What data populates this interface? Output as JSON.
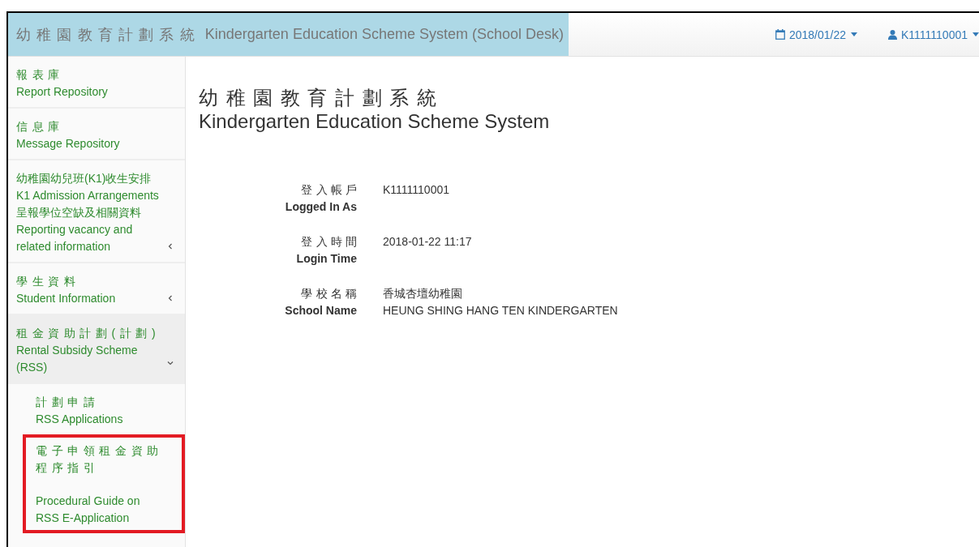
{
  "header": {
    "title_zh": "幼稚園教育計劃系統",
    "title_en": "Kindergarten Education Scheme System (School Desk)",
    "date": "2018/01/22",
    "user": "K1111110001"
  },
  "sidebar": {
    "items": [
      {
        "kind": "spaced",
        "lines": [
          "報表庫",
          "Report Repository"
        ]
      },
      {
        "kind": "spaced",
        "lines": [
          "信息庫",
          "Message Repository"
        ]
      },
      {
        "kind": "compact",
        "lines": [
          "幼稚園幼兒班(K1)收生安排",
          "K1 Admission Arrangements",
          "呈報學位空缺及相關資料",
          "Reporting vacancy and",
          "related information"
        ],
        "expanded": false
      },
      {
        "kind": "spaced",
        "lines": [
          "學生資料",
          "Student Information"
        ],
        "expanded": false
      },
      {
        "kind": "spaced",
        "lines": [
          "租金資助計劃(計劃)",
          "Rental Subsidy Scheme",
          "(RSS)"
        ],
        "expanded": true,
        "children": [
          {
            "lines": [
              "計劃申請",
              "RSS Applications"
            ],
            "highlighted": false
          },
          {
            "lines": [
              "電子申領租金資助程序指引",
              "Procedural Guide on RSS E-Application"
            ],
            "highlighted": true
          }
        ]
      }
    ]
  },
  "main": {
    "title_zh": "幼稚園教育計劃系統",
    "title_en": "Kindergarten Education Scheme System",
    "fields": [
      {
        "label_zh": "登入帳戶",
        "label_en": "Logged In As",
        "values": [
          "K1111110001"
        ]
      },
      {
        "label_zh": "登入時間",
        "label_en": "Login Time",
        "values": [
          "2018-01-22 11:17"
        ]
      },
      {
        "label_zh": "學校名稱",
        "label_en": "School Name",
        "values": [
          "香城杏壇幼稚園",
          "HEUNG SHING HANG TEN KINDERGARTEN"
        ]
      }
    ]
  }
}
